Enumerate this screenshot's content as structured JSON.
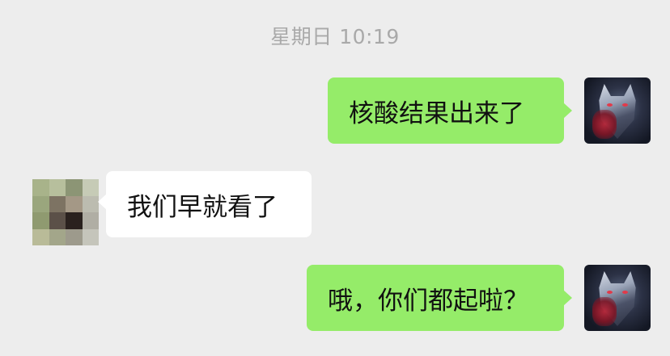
{
  "chat": {
    "timestamp": "星期日 10:19",
    "messages": [
      {
        "sender": "self",
        "text": "核酸结果出来了"
      },
      {
        "sender": "other",
        "text": "我们早就看了"
      },
      {
        "sender": "self",
        "text": "哦，你们都起啦？"
      }
    ]
  },
  "colors": {
    "background": "#ededed",
    "self_bubble": "#95ec69",
    "other_bubble": "#ffffff",
    "timestamp_text": "#a9a9a9"
  },
  "icons": {
    "self_avatar": "wolf-avatar-icon",
    "other_avatar": "pixelated-avatar-icon"
  }
}
